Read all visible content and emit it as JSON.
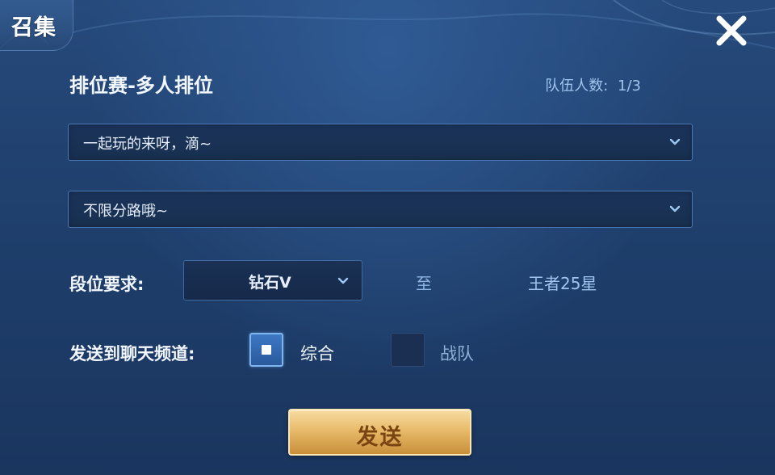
{
  "dialog": {
    "title": "召集",
    "close_icon": "close-icon"
  },
  "mode": {
    "title": "排位赛-多人排位",
    "team_count_label": "队伍人数:",
    "team_count_value": "1/3"
  },
  "dropdowns": {
    "message": {
      "value": "一起玩的来呀，滴~"
    },
    "lane": {
      "value": "不限分路哦~"
    }
  },
  "rank": {
    "label": "段位要求:",
    "min_value": "钻石V",
    "to_text": "至",
    "max_value": "王者25星"
  },
  "channel": {
    "label": "发送到聊天频道:",
    "options": [
      {
        "label": "综合",
        "checked": true
      },
      {
        "label": "战队",
        "checked": false
      }
    ]
  },
  "send_button": {
    "label": "发送"
  },
  "colors": {
    "background": "#213f6d",
    "accent_gold": "#e8bb6a",
    "text_light_blue": "#9fc5ee"
  }
}
